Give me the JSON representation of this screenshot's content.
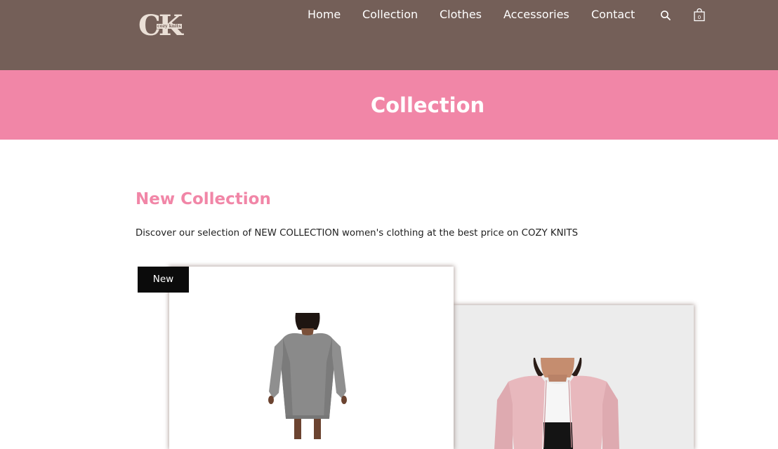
{
  "header": {
    "logo": {
      "letters": "CK",
      "text": "cozy knits"
    },
    "nav": [
      {
        "label": "Home"
      },
      {
        "label": "Collection"
      },
      {
        "label": "Clothes"
      },
      {
        "label": "Accessories"
      },
      {
        "label": "Contact"
      }
    ],
    "icons": [
      "search-icon",
      "shopping-bag-icon"
    ],
    "cart_count": "0"
  },
  "banner": {
    "title": "Collection"
  },
  "section": {
    "title": "New Collection",
    "description": "Discover our selection of NEW COLLECTION women's clothing at the best price on COZY KNITS"
  },
  "products": [
    {
      "badge": "New",
      "image": "grey-knit-dress"
    },
    {
      "image": "pink-knit-cardigan"
    }
  ],
  "colors": {
    "header_bg": "#745f58",
    "banner_bg": "#f186a7",
    "accent": "#f186a7",
    "badge_bg": "#0b0b0b"
  }
}
